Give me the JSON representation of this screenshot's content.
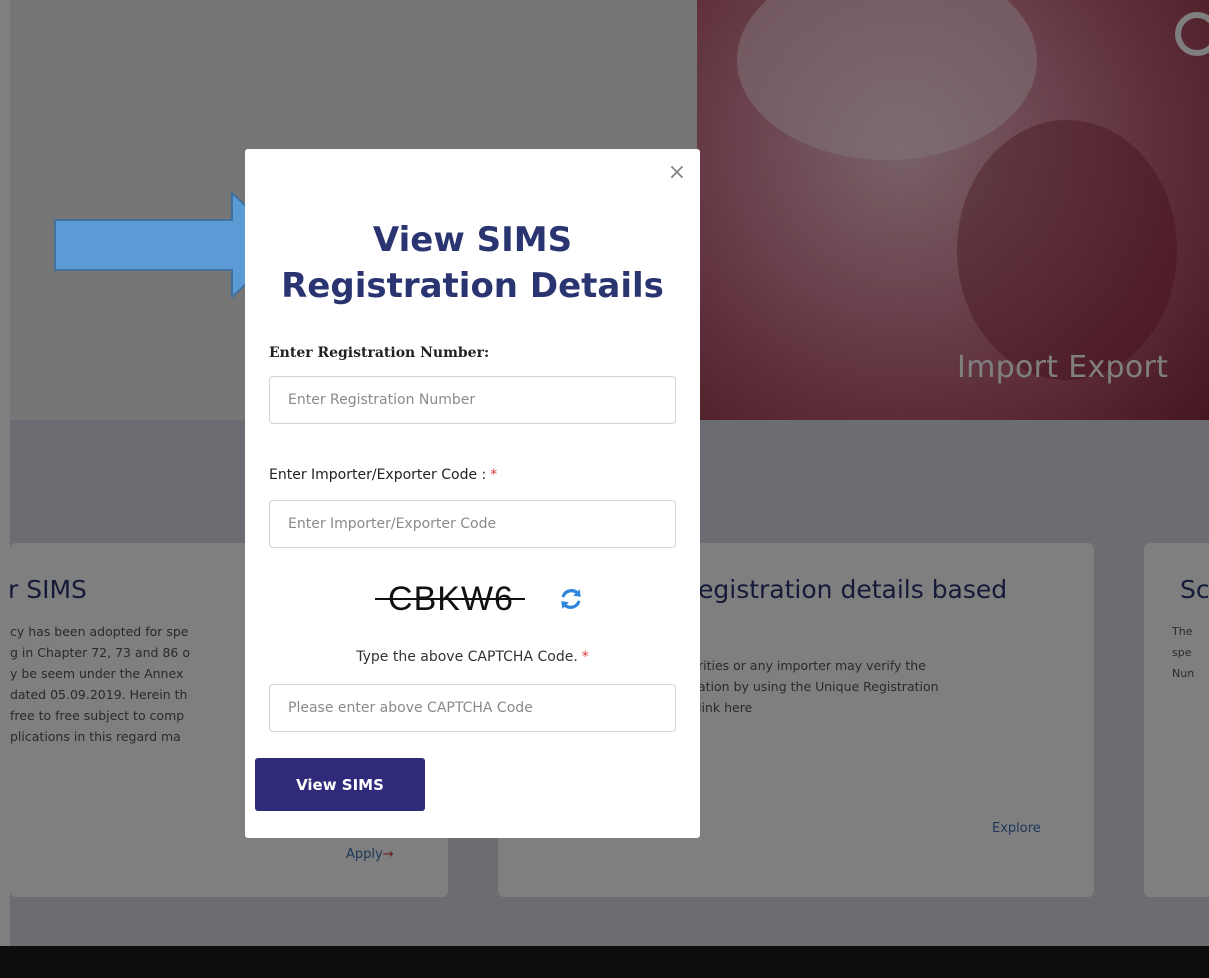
{
  "background": {
    "hero_caption": "Import Export",
    "cards": [
      {
        "title": "r SIMS",
        "lines": [
          "cy has been adopted for spe",
          "g in Chapter 72, 73 and 86 o",
          "y be seem under the Annex",
          " dated 05.09.2019. Herein th",
          "free to free subject to comp",
          "plications in this regard ma"
        ],
        "link": "Apply",
        "link_arrow": "→"
      },
      {
        "title": "egistration details based",
        "lines": [
          "rities or any importer may verify the",
          "ation by using the Unique Registration",
          " link here"
        ],
        "link": "Explore"
      },
      {
        "title": "Sc",
        "lines": [
          "The",
          "spe",
          "Nun"
        ]
      }
    ]
  },
  "modal": {
    "close_label": "×",
    "title_line1": "View SIMS",
    "title_line2": "Registration Details",
    "reg_label": "Enter Registration Number:",
    "reg_placeholder": "Enter Registration Number",
    "iec_label": "Enter Importer/Exporter Code :",
    "iec_placeholder": "Enter Importer/Exporter Code",
    "required_mark": "*",
    "captcha_text": "CBKW6",
    "captcha_label": "Type the above CAPTCHA Code.",
    "captcha_placeholder": "Please enter above CAPTCHA Code",
    "submit_label": "View SIMS"
  },
  "icons": {
    "close": "close-icon",
    "refresh": "refresh-icon",
    "play": "play-icon",
    "pointer_arrow": "blue-arrow-icon"
  },
  "colors": {
    "primary": "#2f2a7a",
    "title": "#2a3470",
    "required": "#e03a3a",
    "arrow": "#5b9bd5",
    "refresh": "#2e86de"
  }
}
